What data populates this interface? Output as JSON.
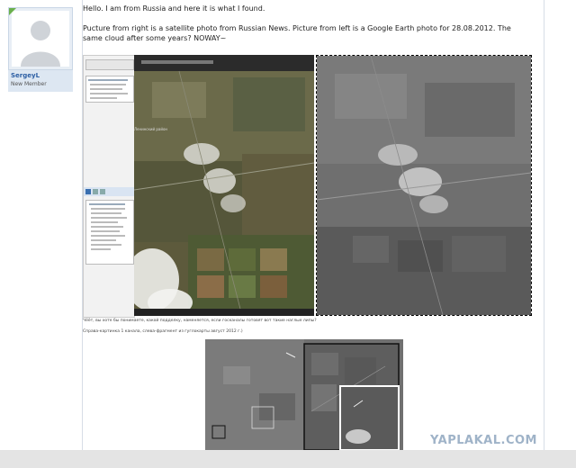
{
  "user": {
    "name": "SergeyL",
    "rank": "New Member"
  },
  "post": {
    "line1": "Hello. I am from Russia and here it is what I found.",
    "line2": "Pucture from right is a satellite photo from Russian News. Picture from left is a Google Earth photo for 28.08.2012. The same cloud after some years? NOWAY~",
    "caption1": "Чёёт, вы хоте бы понимаете, какой подделку, наменяется, если госканалы готовят вот такие наглые липы?",
    "caption2": "Справа-картинка 1 канала, слева-фрагмент из гуглокарты август 2012 г.)",
    "map_label": "Ленинский район"
  },
  "watermark": "YAPLAKAL.COM",
  "colors": {
    "accent": "#2d5fa4",
    "watermark": "#9fb3c8"
  }
}
